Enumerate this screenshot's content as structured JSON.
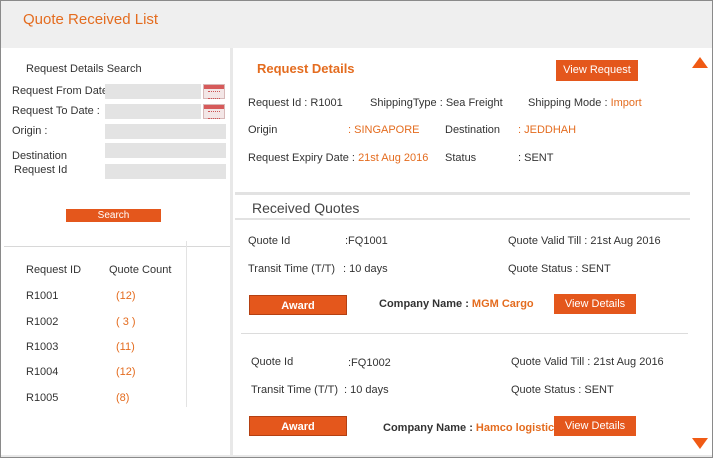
{
  "header": {
    "title": "Quote Received List"
  },
  "search": {
    "title": "Request Details Search",
    "from_label": "Request From Date",
    "to_label": "Request To Date :",
    "origin_label": "Origin :",
    "destination_label": "Destination",
    "request_id_label": "Request Id",
    "button": "Search"
  },
  "request_list": {
    "headers": [
      "Request ID",
      "Quote Count"
    ],
    "rows": [
      {
        "id": "R1001",
        "count": "(12)"
      },
      {
        "id": "R1002",
        "count": "( 3 )"
      },
      {
        "id": "R1003",
        "count": "(11)"
      },
      {
        "id": "R1004",
        "count": "(12)"
      },
      {
        "id": "R1005",
        "count": "(8)"
      }
    ]
  },
  "details": {
    "title": "Request Details",
    "view_button": "View Request",
    "request_id": "Request Id : R1001",
    "shipping_type": "ShippingType : Sea Freight",
    "shipping_mode_label": "Shipping Mode : ",
    "shipping_mode_value": "Import",
    "origin_label": "Origin",
    "origin_value": ": SINGAPORE",
    "destination_label": "Destination",
    "destination_value": ": JEDDHAH",
    "expiry_label": "Request Expiry Date : ",
    "expiry_value": "21st Aug 2016",
    "status_label": "Status",
    "status_value": ": SENT"
  },
  "received_quotes": {
    "title": "Received Quotes",
    "quotes": [
      {
        "quote_id_label": "Quote Id",
        "quote_id_value": ":FQ1001",
        "valid_till": "Quote Valid Till : 21st Aug 2016",
        "transit_label": "Transit Time (T/T)",
        "transit_value": ": 10 days",
        "status": "Quote Status   : SENT",
        "award_button": "Award",
        "company_label": "Company Name : ",
        "company_value": "MGM Cargo",
        "view_button": "View Details"
      },
      {
        "quote_id_label": "Quote Id",
        "quote_id_value": ":FQ1002",
        "valid_till": "Quote Valid Till : 21st Aug 2016",
        "transit_label": "Transit Time (T/T)",
        "transit_value": ": 10 days",
        "status": "Quote Status   : SENT",
        "award_button": "Award",
        "company_label": "Company Name : ",
        "company_value": "Hamco logistics",
        "view_button": "View Details"
      }
    ]
  },
  "colors": {
    "accent": "#e46c1f",
    "button": "#e4571c",
    "scroll_arrow": "#f05a14"
  }
}
